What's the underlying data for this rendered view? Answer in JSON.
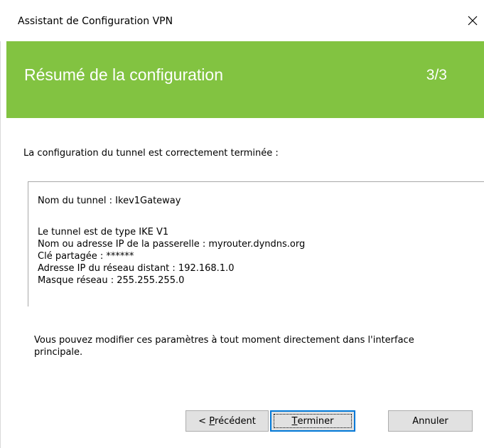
{
  "window": {
    "title": "Assistant de Configuration VPN",
    "close_symbol": "✕"
  },
  "banner": {
    "heading": "Résumé de la configuration",
    "step": "3/3",
    "color": "#82c341"
  },
  "content": {
    "intro": "La configuration du tunnel est correctement terminée :",
    "summary": {
      "tunnel_name": "Nom du tunnel : Ikev1Gateway",
      "tunnel_type": "Le tunnel est de type IKE V1",
      "gateway": "Nom ou adresse IP de la passerelle : myrouter.dyndns.org",
      "shared_key": "Clé partagée : ******",
      "remote_network": "Adresse IP du réseau distant : 192.168.1.0",
      "netmask": "Masque réseau : 255.255.255.0"
    },
    "footer_note": "Vous pouvez modifier ces paramètres à tout moment directement dans l'interface principale."
  },
  "buttons": {
    "previous": {
      "prefix": "< ",
      "mnemonic": "P",
      "rest": "récédent"
    },
    "finish": {
      "mnemonic": "T",
      "rest": "erminer"
    },
    "cancel": "Annuler"
  },
  "icons": {
    "close": "close-icon"
  }
}
